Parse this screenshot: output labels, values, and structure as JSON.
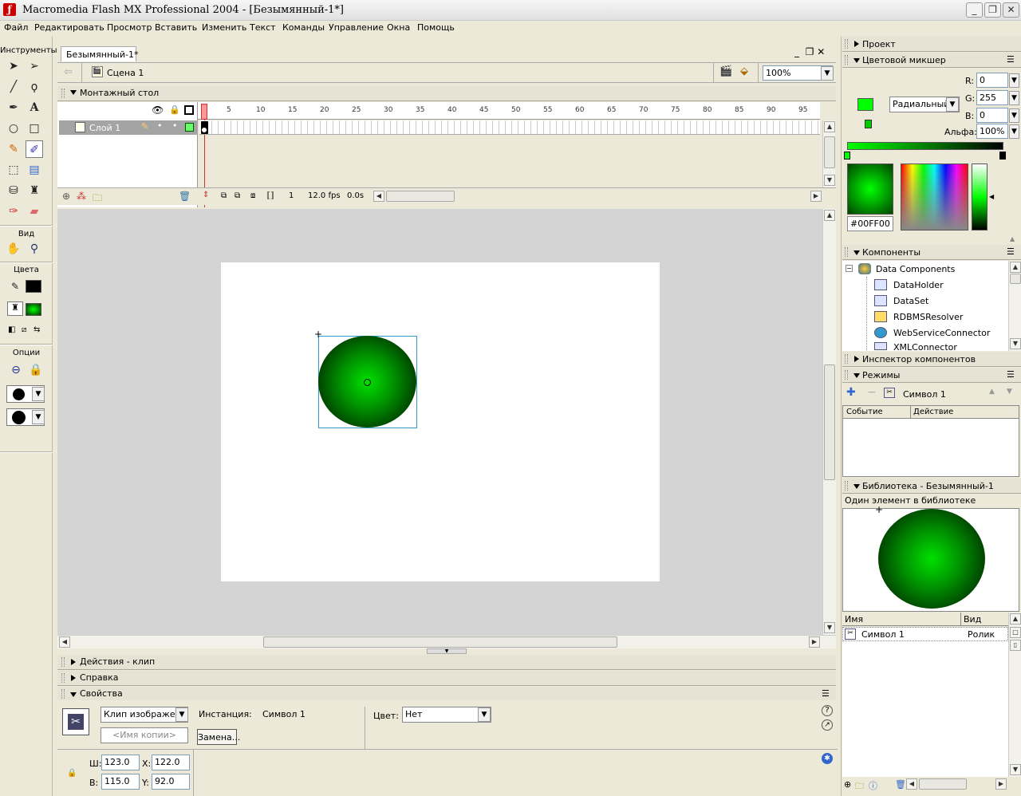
{
  "window": {
    "title": "Macromedia Flash MX Professional 2004 - [Безымянный-1*]"
  },
  "menu": [
    "Файл",
    "Редактировать",
    "Просмотр",
    "Вставить",
    "Изменить",
    "Текст",
    "Команды",
    "Управление",
    "Окна",
    "Помощь"
  ],
  "tools": {
    "title": "Инструменты",
    "view_label": "Вид",
    "colors_label": "Цвета",
    "options_label": "Опции"
  },
  "document": {
    "tab": "Безымянный-1*",
    "scene": "Сцена 1",
    "zoom": "100%"
  },
  "timeline": {
    "title": "Монтажный стол",
    "layer": "Слой 1",
    "ruler": [
      "1",
      "5",
      "10",
      "15",
      "20",
      "25",
      "30",
      "35",
      "40",
      "45",
      "50",
      "55",
      "60",
      "65",
      "70",
      "75",
      "80",
      "85",
      "90",
      "95"
    ],
    "current_frame": "1",
    "fps": "12.0 fps",
    "time": "0.0s"
  },
  "panels": {
    "actions": "Действия - клип",
    "help": "Справка",
    "properties": "Свойства"
  },
  "properties": {
    "type": "Клип изображени",
    "instance_placeholder": "<Имя копии>",
    "instance_label": "Инстанция:",
    "instance_value": "Символ 1",
    "swap_button": "Замена...",
    "color_label": "Цвет:",
    "color_value": "Нет",
    "w_label": "Ш:",
    "w": "123.0",
    "h_label": "В:",
    "h": "115.0",
    "x_label": "X:",
    "x": "122.0",
    "y_label": "Y:",
    "y": "92.0"
  },
  "right": {
    "project": "Проект",
    "mixer": {
      "title": "Цветовой микшер",
      "fill_type": "Радиальный",
      "r_label": "R:",
      "r": "0",
      "g_label": "G:",
      "g": "255",
      "b_label": "B:",
      "b": "0",
      "alpha_label": "Альфа:",
      "alpha": "100%",
      "hex": "#00FF00"
    },
    "components": {
      "title": "Компоненты",
      "root": "Data Components",
      "items": [
        "DataHolder",
        "DataSet",
        "RDBMSResolver",
        "WebServiceConnector",
        "XMLConnector"
      ]
    },
    "inspector": "Инспектор компонентов",
    "behaviors": {
      "title": "Режимы",
      "symbol": "Символ 1",
      "col_event": "Событие",
      "col_action": "Действие"
    },
    "library": {
      "title": "Библиотека - Безымянный-1",
      "count": "Один элемент в библиотеке",
      "col_name": "Имя",
      "col_kind": "Вид",
      "item_name": "Символ 1",
      "item_kind": "Ролик"
    }
  },
  "colors": {
    "accent_green": "#00ff00",
    "stage_bg": "#ffffff",
    "pasteboard": "#d4d4d4"
  }
}
